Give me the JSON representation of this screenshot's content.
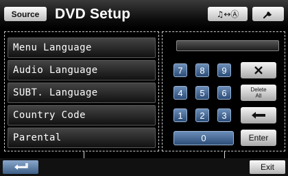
{
  "header": {
    "source_label": "Source",
    "title": "DVD Setup",
    "audio_mode_label": "♫↔Ⓐ",
    "setup_icon": "wrench-icon"
  },
  "menu": {
    "items": [
      {
        "label": "Menu Language"
      },
      {
        "label": "Audio Language"
      },
      {
        "label": "SUBT. Language"
      },
      {
        "label": "Country Code"
      },
      {
        "label": "Parental"
      }
    ]
  },
  "keypad": {
    "display_value": "",
    "keys": {
      "k7": "7",
      "k8": "8",
      "k9": "9",
      "k4": "4",
      "k5": "5",
      "k6": "6",
      "k1": "1",
      "k2": "2",
      "k3": "3",
      "k0": "0",
      "clear_icon": "close-icon",
      "delete_all": "Delete All",
      "delete_all_line1": "Delete",
      "delete_all_line2": "All",
      "backspace_icon": "backspace-arrow-icon",
      "enter": "Enter"
    }
  },
  "footer": {
    "back_icon": "return-arrow-icon",
    "exit_label": "Exit"
  },
  "colors": {
    "key_blue": "#4a6fa0",
    "key_white": "#e8e8e8",
    "background": "#000000"
  }
}
